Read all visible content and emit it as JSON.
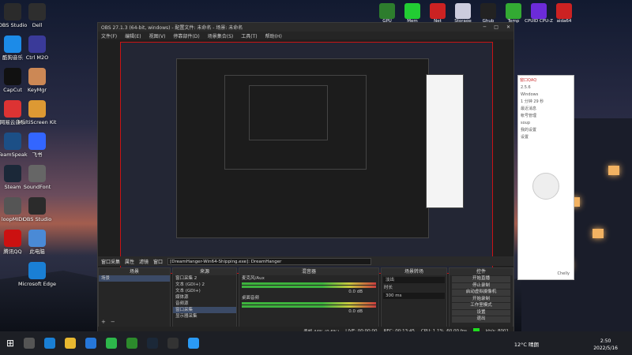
{
  "desktop_icons": [
    {
      "label": "OBS Studio",
      "color": "#2b2b2b"
    },
    {
      "label": "酷狗音乐",
      "color": "#1c8be8"
    },
    {
      "label": "CapCut",
      "color": "#111"
    },
    {
      "label": "网易云音乐",
      "color": "#d33"
    },
    {
      "label": "TeamSpeak",
      "color": "#1c4f86"
    },
    {
      "label": "Steam",
      "color": "#1b2838"
    },
    {
      "label": "loopMIDI",
      "color": "#555"
    },
    {
      "label": "腾讯QQ",
      "color": "#c11"
    },
    {
      "label": "Dell",
      "color": "#2e2e2e"
    },
    {
      "label": "Ctrl M2O",
      "color": "#3a3a99"
    },
    {
      "label": "KeyMgr",
      "color": "#c85"
    },
    {
      "label": "MultiScreen Kit",
      "color": "#d93"
    },
    {
      "label": "飞书",
      "color": "#36f"
    },
    {
      "label": "SoundFont",
      "color": "#666"
    },
    {
      "label": "OBS Studio",
      "color": "#2b2b2b"
    },
    {
      "label": "此电脑",
      "color": "#4a8ad6"
    },
    {
      "label": "Microsoft Edge",
      "color": "#1a7fd4"
    }
  ],
  "tray_icons": [
    {
      "label": "GPU",
      "color": "#2d7d2d"
    },
    {
      "label": "Mem",
      "color": "#2c3"
    },
    {
      "label": "Net",
      "color": "#c22"
    },
    {
      "label": "Storage",
      "color": "#ccd"
    },
    {
      "label": "Ghub",
      "color": "#222"
    },
    {
      "label": "Temp",
      "color": "#3a3"
    },
    {
      "label": "CPUID CPU-Z",
      "color": "#6c2bd9"
    },
    {
      "label": "aida64",
      "color": "#c22"
    }
  ],
  "obs": {
    "title": "OBS 27.1.3 (64-bit, windows) - 配置文件: 未命名 - 场景: 未命名",
    "menu": [
      "文件(F)",
      "编辑(E)",
      "视图(V)",
      "停靠部件(D)",
      "场景集合(S)",
      "工具(T)",
      "帮助(H)"
    ],
    "source_bar": {
      "name": "窗口采集",
      "props": "属性",
      "filter": "滤镜",
      "window_label": "窗口",
      "window_value": "[DreamHanger-Win64-Shipping.exe]: DreamHanger"
    },
    "scenes": {
      "header": "场景",
      "items": [
        "场景"
      ]
    },
    "sources": {
      "header": "来源",
      "items": [
        "窗口采集 2",
        "文本 (GDI+) 2",
        "文本 (GDI+)",
        "媒体源",
        "音频源",
        "窗口采集",
        "显示器采集"
      ]
    },
    "mixer": {
      "header": "混音器",
      "tracks": [
        {
          "name": "麦克风/Aux",
          "db": "0.0 dB"
        },
        {
          "name": "桌面音频",
          "db": "0.0 dB"
        }
      ]
    },
    "transitions": {
      "header": "场景转场",
      "type": "淡出",
      "duration_label": "时长",
      "duration": "300 ms"
    },
    "controls": {
      "header": "控件",
      "buttons": [
        "开始直播",
        "停止录制",
        "启动虚拟摄像机",
        "开始录制",
        "工作室模式",
        "设置",
        "退出"
      ]
    },
    "status": {
      "dropped": "丢帧 44% (0.6%)",
      "live": "LIVE: 00:00:00",
      "rec": "REC: 00:13:45",
      "cpu": "CPU: 1.1%, 60.00 fps",
      "kbps": "kb/s: 8001"
    }
  },
  "qq": {
    "title": "窗口QAQ",
    "lines": [
      "2.5.6",
      "Windows",
      "1 分钟 29 秒",
      "最近消息",
      "帐号管理",
      "soup",
      "我的设置",
      "设置",
      "Chelly"
    ]
  },
  "taskbar": {
    "weather": "12°C 晴朗",
    "time": "2:50",
    "date": "2022/5/16"
  }
}
